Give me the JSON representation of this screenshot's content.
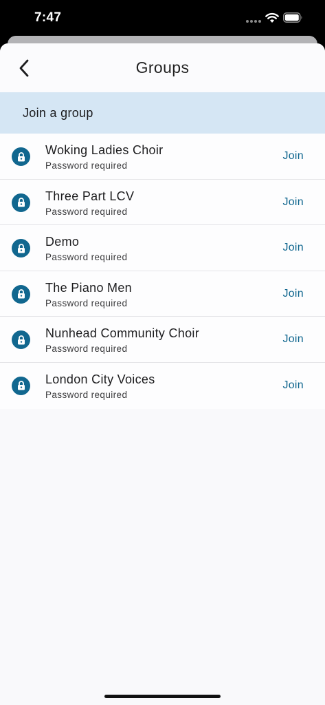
{
  "status_bar": {
    "time": "7:47"
  },
  "nav": {
    "title": "Groups",
    "back_icon": "chevron-left-icon"
  },
  "section": {
    "title": "Join a group"
  },
  "groups": [
    {
      "name": "Woking Ladies Choir",
      "status": "Password required",
      "action": "Join"
    },
    {
      "name": "Three Part LCV",
      "status": "Password required",
      "action": "Join"
    },
    {
      "name": "Demo",
      "status": "Password required",
      "action": "Join"
    },
    {
      "name": "The Piano Men",
      "status": "Password required",
      "action": "Join"
    },
    {
      "name": "Nunhead Community Choir",
      "status": "Password required",
      "action": "Join"
    },
    {
      "name": "London City Voices",
      "status": "Password required",
      "action": "Join"
    }
  ],
  "colors": {
    "accent": "#11678f",
    "section_background": "#d5e6f4"
  }
}
